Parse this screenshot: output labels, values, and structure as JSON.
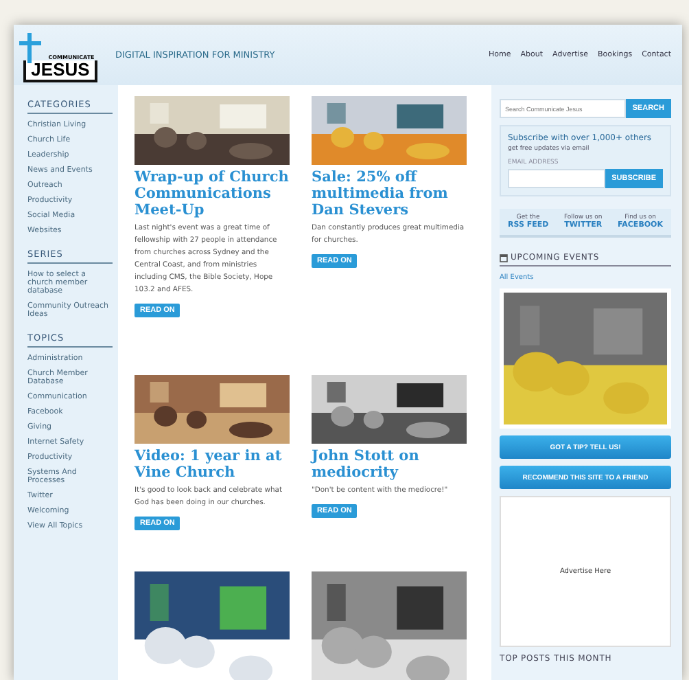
{
  "logo": {
    "top": "COMMUNICATE",
    "bottom": "JESUS"
  },
  "tagline": "DIGITAL INSPIRATION FOR MINISTRY",
  "nav": [
    "Home",
    "About",
    "Advertise",
    "Bookings",
    "Contact"
  ],
  "sidebar": [
    {
      "heading": "CATEGORIES",
      "items": [
        "Christian Living",
        "Church Life",
        "Leadership",
        "News and Events",
        "Outreach",
        "Productivity",
        "Social Media",
        "Websites"
      ]
    },
    {
      "heading": "SERIES",
      "items": [
        "How to select a church member database",
        "Community Outreach Ideas"
      ]
    },
    {
      "heading": "TOPICS",
      "items": [
        "Administration",
        "Church Member Database",
        "Communication",
        "Facebook",
        "Giving",
        "Internet Safety",
        "Productivity",
        "Systems And Processes",
        "Twitter",
        "Welcoming",
        "View All Topics"
      ]
    }
  ],
  "posts": [
    {
      "kind": "picture",
      "title": "Wrap-up of Church Communications Meet-Up",
      "excerpt": "Last night's event was a great time of fellowship with 27 people in attendance from churches across Sydney and the Central Coast, and from ministries including CMS, the Bible Society, Hope 103.2 and AFES.",
      "button": "READ ON"
    },
    {
      "kind": "picture",
      "title": "Sale: 25% off multimedia from Dan Stevers",
      "excerpt": "Dan constantly produces great multimedia for churches.",
      "button": "READ ON"
    },
    {
      "kind": "picture",
      "title": "Video: 1 year in at Vine Church",
      "excerpt": "It's good to look back and celebrate what God has been doing in our churches.",
      "button": "READ ON"
    },
    {
      "kind": "picture",
      "title": "John Stott on mediocrity",
      "excerpt": "\"Don't be content with the mediocre!\"",
      "button": "READ ON"
    }
  ],
  "ads": [
    {
      "kind": "picture"
    },
    {
      "kind": "picture"
    }
  ],
  "search": {
    "placeholder": "Search Communicate Jesus",
    "button": "SEARCH"
  },
  "subscribe": {
    "title": "Subscribe with over 1,000+ others",
    "subtitle": "get free updates via email",
    "label": "EMAIL ADDRESS",
    "button": "SUBSCRIBE"
  },
  "social": [
    {
      "pre": "Get the",
      "label": "RSS FEED"
    },
    {
      "pre": "Follow us on",
      "label": "TWITTER"
    },
    {
      "pre": "Find us on",
      "label": "FACEBOOK"
    }
  ],
  "events": {
    "heading": "UPCOMING EVENTS",
    "link": "All Events",
    "banner": {
      "kind": "picture"
    }
  },
  "actions": [
    "GOT A TIP? TELL US!",
    "RECOMMEND THIS SITE TO A FRIEND"
  ],
  "advert": "Advertise Here",
  "top_posts": "TOP POSTS THIS MONTH"
}
